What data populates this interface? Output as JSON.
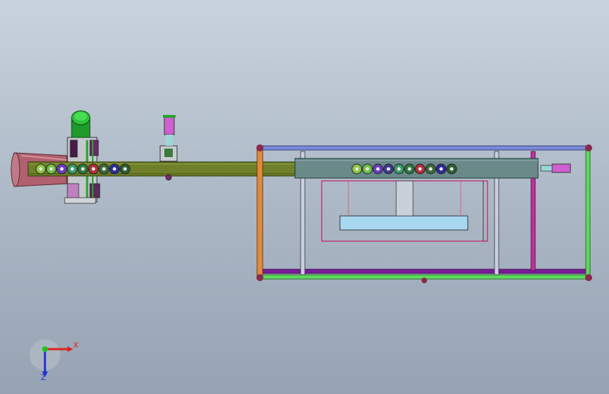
{
  "viewport": {
    "background_top": "#c9d3de",
    "background_bottom": "#96a3b3"
  },
  "triad": {
    "x_label": "X",
    "z_label": "Z",
    "x_color": "#e02020",
    "z_color": "#2030d0",
    "y_color": "#20c020"
  },
  "model": {
    "roller_colors_left": [
      "#8ec63f",
      "#6fbf4a",
      "#6a3cc0",
      "#3a9a6a",
      "#2d7a3c",
      "#b0303a",
      "#3c6a3c",
      "#2a2aa0",
      "#2f5f2f"
    ],
    "roller_colors_right": [
      "#8ec63f",
      "#6fbf4a",
      "#6a3cc0",
      "#3a3a90",
      "#3a9a6a",
      "#2d7a3c",
      "#b0303a",
      "#3c6a3c",
      "#2a2aa0",
      "#2f5f2f"
    ],
    "conveyor_color": "#6f7f2a",
    "frame_green": "#5fd85f",
    "frame_purple": "#7a1a9a",
    "motor_color": "#1f9a2a",
    "hopper_color": "#b0606e"
  }
}
